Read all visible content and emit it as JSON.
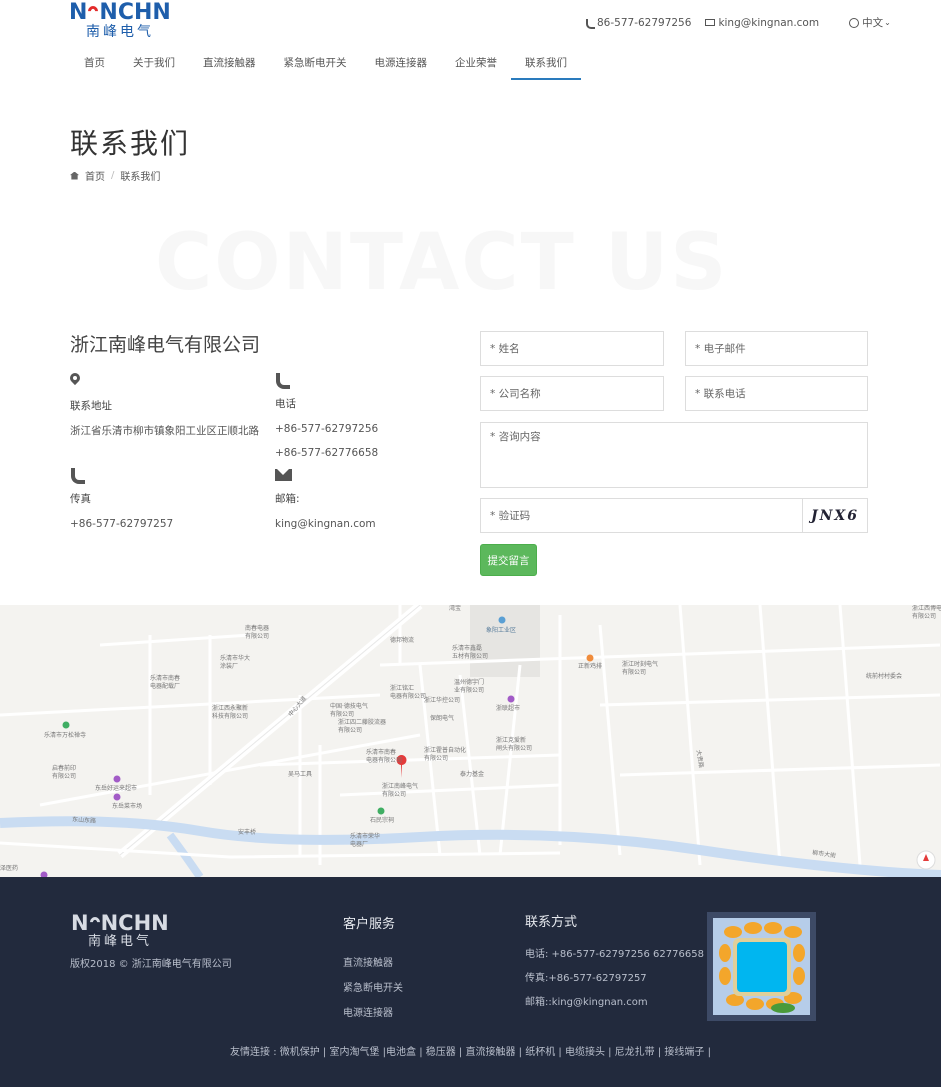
{
  "header": {
    "logo_word_left": "N",
    "logo_word_right": "NCHN",
    "logo_sub": "南峰电气",
    "phone": "86-577-62797256",
    "email": "king@kingnan.com",
    "language": "中文"
  },
  "nav": [
    {
      "label": "首页",
      "active": false
    },
    {
      "label": "关于我们",
      "active": false
    },
    {
      "label": "直流接触器",
      "active": false
    },
    {
      "label": "紧急断电开关",
      "active": false
    },
    {
      "label": "电源连接器",
      "active": false
    },
    {
      "label": "企业荣誉",
      "active": false
    },
    {
      "label": "联系我们",
      "active": true
    }
  ],
  "page": {
    "title": "联系我们",
    "breadcrumb_home": "首页",
    "breadcrumb_sep": "/",
    "breadcrumb_current": "联系我们",
    "watermark": "CONTACT US"
  },
  "company": {
    "name": "浙江南峰电气有限公司",
    "address_label": "联系地址",
    "address": "浙江省乐清市柳市镇象阳工业区正顺北路",
    "phone_label": "电话",
    "phone1": "+86-577-62797256",
    "phone2": "+86-577-62776658",
    "fax_label": "传真",
    "fax": "+86-577-62797257",
    "email_label": "邮箱:",
    "email": "king@kingnan.com"
  },
  "form": {
    "name_placeholder": "* 姓名",
    "email_placeholder": "* 电子邮件",
    "company_placeholder": "* 公司名称",
    "phone_placeholder": "* 联系电话",
    "message_placeholder": "* 咨询内容",
    "captcha_placeholder": "* 验证码",
    "captcha_text": "JNX6",
    "submit_label": "提交留言"
  },
  "map": {
    "labels": [
      {
        "text": "南春电器\n有限公司"
      },
      {
        "text": "乐清市华大\n涂装厂"
      },
      {
        "text": "乐清市南春\n电器配载厂"
      },
      {
        "text": "浙江西永聚新\n科技有限公司"
      },
      {
        "text": "乐清市万松禅寺"
      },
      {
        "text": "启春前印\n有限公司"
      },
      {
        "text": "东岳好运来超市"
      },
      {
        "text": "东岳菜市场"
      },
      {
        "text": "德邦物流"
      },
      {
        "text": "乐清市鑫磊\n五材有限公司"
      },
      {
        "text": "象阳工业区"
      },
      {
        "text": "温州德宇门\n业有限公司"
      },
      {
        "text": "浙江铭汇\n电器有限公司"
      },
      {
        "text": "浙江华控公司"
      },
      {
        "text": "中国·德技电气\n有限公司"
      },
      {
        "text": "浙江四二藤胶流器\n有限公司"
      },
      {
        "text": "保朗电气"
      },
      {
        "text": "浙联超市"
      },
      {
        "text": "乐清市南春\n电器有限公司"
      },
      {
        "text": "浙江霍普自动化\n有限公司"
      },
      {
        "text": "浙江克爱新\n闸头有限公司"
      },
      {
        "text": "泰力基金"
      },
      {
        "text": "吴马工具"
      },
      {
        "text": "浙江南峰电气\n有限公司"
      },
      {
        "text": "石民宗祠"
      },
      {
        "text": "乐清市荣华\n电器厂"
      },
      {
        "text": "安丰桥"
      },
      {
        "text": "正新鸡排"
      },
      {
        "text": "浙江时刻电气\n有限公司"
      },
      {
        "text": "统前村村委会"
      },
      {
        "text": "浙江西博电器\n有限公司"
      },
      {
        "text": "中心大道"
      },
      {
        "text": "大贵路"
      },
      {
        "text": "柳市大街"
      },
      {
        "text": "东山东路"
      },
      {
        "text": "泽医药"
      },
      {
        "text": "湾宝"
      }
    ]
  },
  "footer": {
    "logo_word_left": "N",
    "logo_word_right": "NCHN",
    "logo_sub": "南峰电气",
    "copyright": "版权2018 © 浙江南峰电气有限公司",
    "service_title": "客户服务",
    "service_links": [
      "直流接触器",
      "紧急断电开关",
      "电源连接器"
    ],
    "contact_title": "联系方式",
    "contact_phone": "电话: +86-577-62797256 62776658",
    "contact_fax": "传真:+86-577-62797257",
    "contact_email": "邮箱::king@kingnan.com",
    "friend_links": "友情连接 : 微机保护 | 室内淘气堡 |电池盒 | 稳压器 | 直流接触器 | 纸杯机 | 电缆接头 | 尼龙扎带 | 接线端子 |"
  },
  "colors": {
    "brand_blue": "#1e5eab",
    "nav_active": "#2a7bbd",
    "submit_green": "#5cb85c",
    "footer_bg": "#222a3d"
  }
}
